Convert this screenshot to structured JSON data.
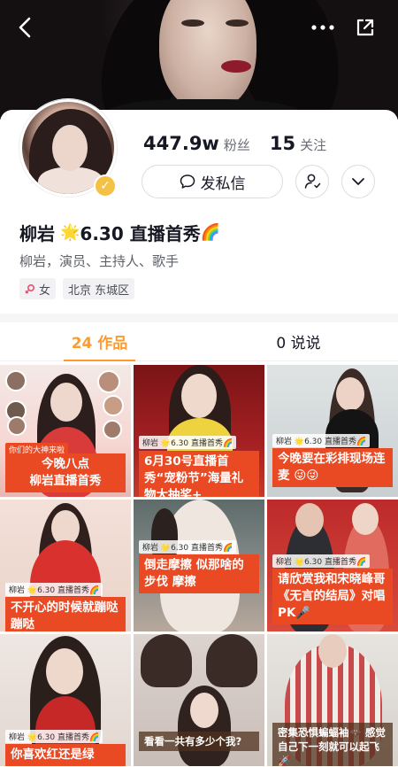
{
  "profile": {
    "display_name": "柳岩",
    "name_star": "🌟",
    "name_suffix": "6.30 直播首秀",
    "name_rainbow": "🌈",
    "bio": "柳岩，演员、主持人、歌手",
    "gender_tag": "女",
    "location_tag": "北京 东城区",
    "fans_count": "447.9w",
    "fans_label": "粉丝",
    "following_count": "15",
    "following_label": "关注",
    "message_button": "发私信",
    "verified": true
  },
  "icons": {
    "back": "chevron-left-icon",
    "more": "more-dots-icon",
    "share": "share-external-icon",
    "message": "chat-bubble-icon",
    "follow": "user-add-icon",
    "expand": "chevron-down-icon",
    "gender": "female-icon",
    "verify": "verified-badge-icon"
  },
  "tabs": [
    {
      "label": "24 作品",
      "active": true
    },
    {
      "label": "0 说说",
      "active": false
    }
  ],
  "colors": {
    "accent": "#fe9a2e",
    "caption_red": "#e94a23",
    "verify_gold": "#f5c046"
  },
  "videos": [
    {
      "chip": "",
      "mini": "你们的大神来啦",
      "caption": "今晚八点\n柳岩直播首秀"
    },
    {
      "chip": "柳岩 🌟6.30 直播首秀🌈",
      "caption": "6月30号直播首秀“宠粉节”海量礼物大抽奖+"
    },
    {
      "chip": "柳岩 🌟6.30 直播首秀🌈",
      "caption": "今晚要在彩排现场连麦 😜😜"
    },
    {
      "chip": "柳岩 🌟6.30 直播首秀🌈",
      "caption": "不开心的时候就蹦哒蹦哒"
    },
    {
      "chip": "柳岩 🌟6.30 直播首秀🌈",
      "caption": "倒走摩擦 似那啥的步伐 摩擦"
    },
    {
      "chip": "柳岩 🌟6.30 直播首秀🌈",
      "caption": "请欣赏我和宋晓峰哥《无言的结局》对唱PK🎤"
    },
    {
      "chip": "柳岩 🌟6.30 直播首秀🌈",
      "caption": "你喜欢红还是绿"
    },
    {
      "chip": "",
      "caption": "看看一共有多少个我?"
    },
    {
      "chip": "",
      "caption": "密集恐惧蝙蝠袖🦇 感觉自己下一刻就可以起飞🚀"
    }
  ]
}
